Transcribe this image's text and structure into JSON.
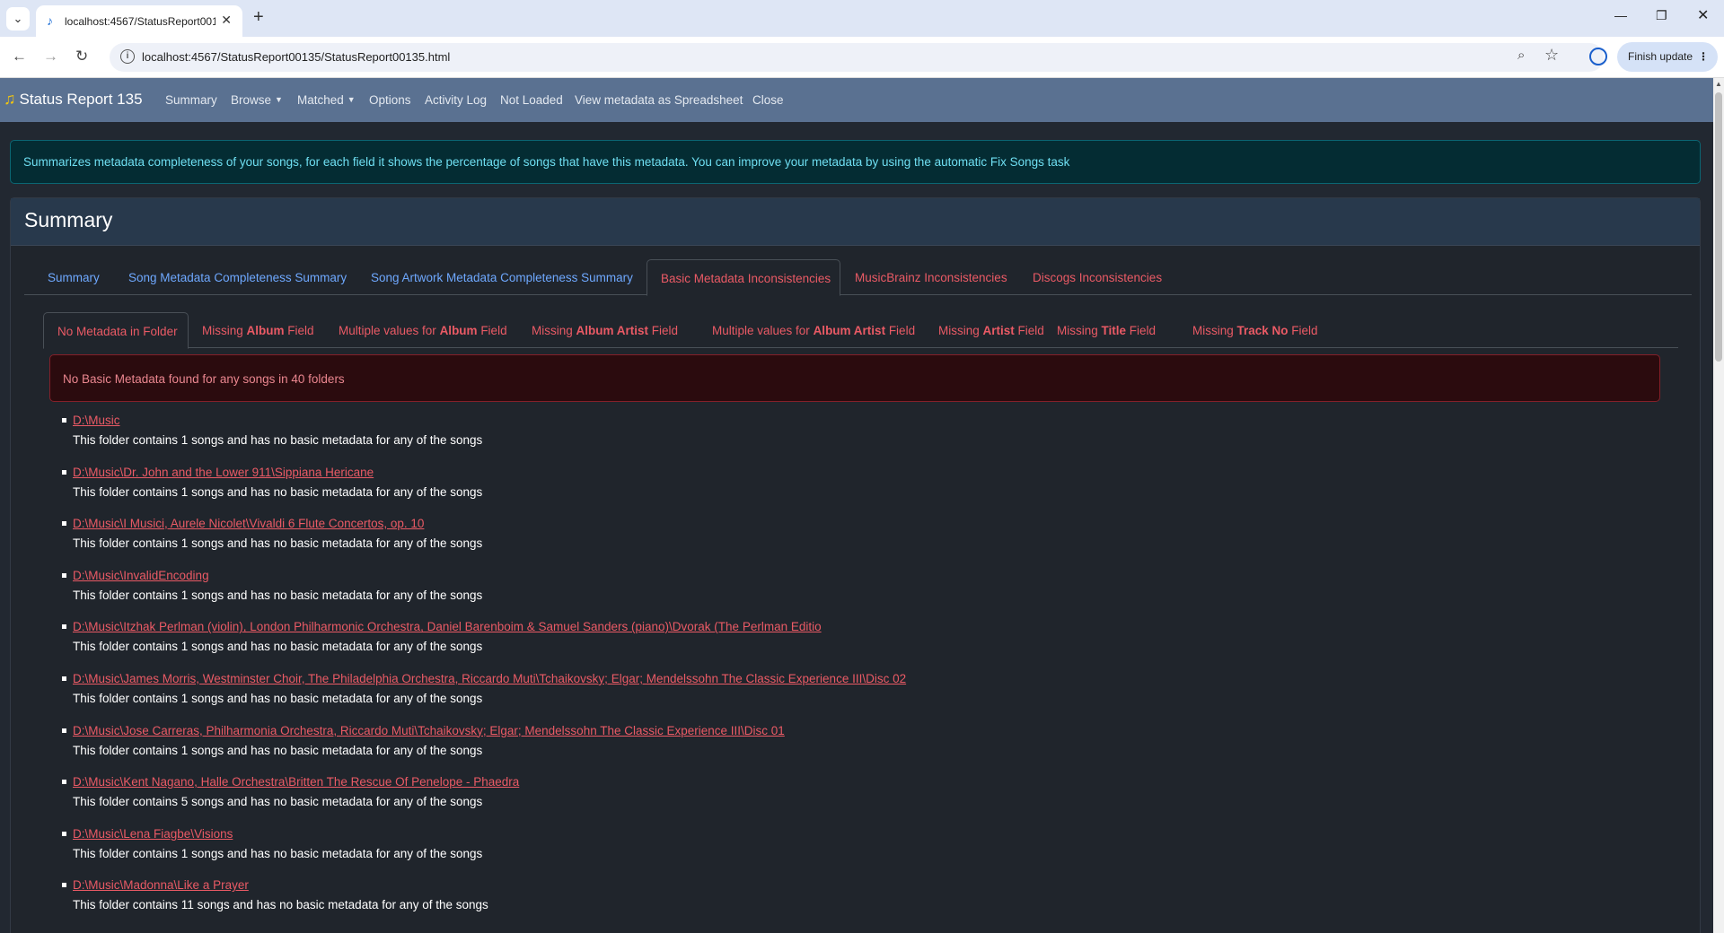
{
  "browser": {
    "tab_title": "localhost:4567/StatusReport00135",
    "url": "localhost:4567/StatusReport00135/StatusReport00135.html",
    "finish_update": "Finish update"
  },
  "navbar": {
    "brand": "Status Report 135",
    "items": [
      "Summary",
      "Browse",
      "Matched",
      "Options",
      "Activity Log",
      "Not Loaded",
      "View metadata as Spreadsheet",
      "Close"
    ]
  },
  "info_text": "Summarizes metadata completeness of your songs, for each field it shows the percentage of songs that have this metadata. You can improve your metadata by using the automatic Fix Songs task",
  "card_title": "Summary",
  "main_tabs": [
    "Summary",
    "Song Metadata Completeness Summary",
    "Song Artwork Metadata Completeness Summary",
    "Basic Metadata Inconsistencies",
    "MusicBrainz Inconsistencies",
    "Discogs Inconsistencies"
  ],
  "sub_tabs": [
    {
      "pre": "No Metadata in Folder",
      "bold": "",
      "post": ""
    },
    {
      "pre": "Missing ",
      "bold": "Album",
      "post": " Field"
    },
    {
      "pre": "Multiple values for ",
      "bold": "Album",
      "post": " Field"
    },
    {
      "pre": "Missing ",
      "bold": "Album Artist",
      "post": " Field"
    },
    {
      "pre": "Multiple values for ",
      "bold": "Album Artist",
      "post": " Field"
    },
    {
      "pre": "Missing ",
      "bold": "Artist",
      "post": " Field"
    },
    {
      "pre": "Missing ",
      "bold": "Title",
      "post": " Field"
    },
    {
      "pre": "Missing ",
      "bold": "Track No",
      "post": " Field"
    }
  ],
  "alert_text": "No Basic Metadata found for any songs in 40 folders",
  "folders": [
    {
      "path": "D:\\Music",
      "desc": "This folder contains 1 songs and has no basic metadata for any of the songs"
    },
    {
      "path": "D:\\Music\\Dr. John and the Lower 911\\Sippiana Hericane",
      "desc": "This folder contains 1 songs and has no basic metadata for any of the songs"
    },
    {
      "path": "D:\\Music\\I Musici, Aurele Nicolet\\Vivaldi 6 Flute Concertos, op. 10",
      "desc": "This folder contains 1 songs and has no basic metadata for any of the songs"
    },
    {
      "path": "D:\\Music\\InvalidEncoding",
      "desc": "This folder contains 1 songs and has no basic metadata for any of the songs"
    },
    {
      "path": "D:\\Music\\Itzhak Perlman (violin), London Philharmonic Orchestra, Daniel Barenboim & Samuel Sanders (piano)\\Dvorak (The Perlman Editio",
      "desc": "This folder contains 1 songs and has no basic metadata for any of the songs"
    },
    {
      "path": "D:\\Music\\James Morris, Westminster Choir, The Philadelphia Orchestra, Riccardo Muti\\Tchaikovsky; Elgar; Mendelssohn The Classic Experience III\\Disc 02",
      "desc": "This folder contains 1 songs and has no basic metadata for any of the songs"
    },
    {
      "path": "D:\\Music\\Jose Carreras, Philharmonia Orchestra, Riccardo Muti\\Tchaikovsky; Elgar; Mendelssohn The Classic Experience III\\Disc 01",
      "desc": "This folder contains 1 songs and has no basic metadata for any of the songs"
    },
    {
      "path": "D:\\Music\\Kent Nagano, Halle Orchestra\\Britten The Rescue Of Penelope - Phaedra",
      "desc": "This folder contains 5 songs and has no basic metadata for any of the songs"
    },
    {
      "path": "D:\\Music\\Lena Fiagbe\\Visions",
      "desc": "This folder contains 1 songs and has no basic metadata for any of the songs"
    },
    {
      "path": "D:\\Music\\Madonna\\Like a Prayer",
      "desc": "This folder contains 11 songs and has no basic metadata for any of the songs"
    }
  ]
}
